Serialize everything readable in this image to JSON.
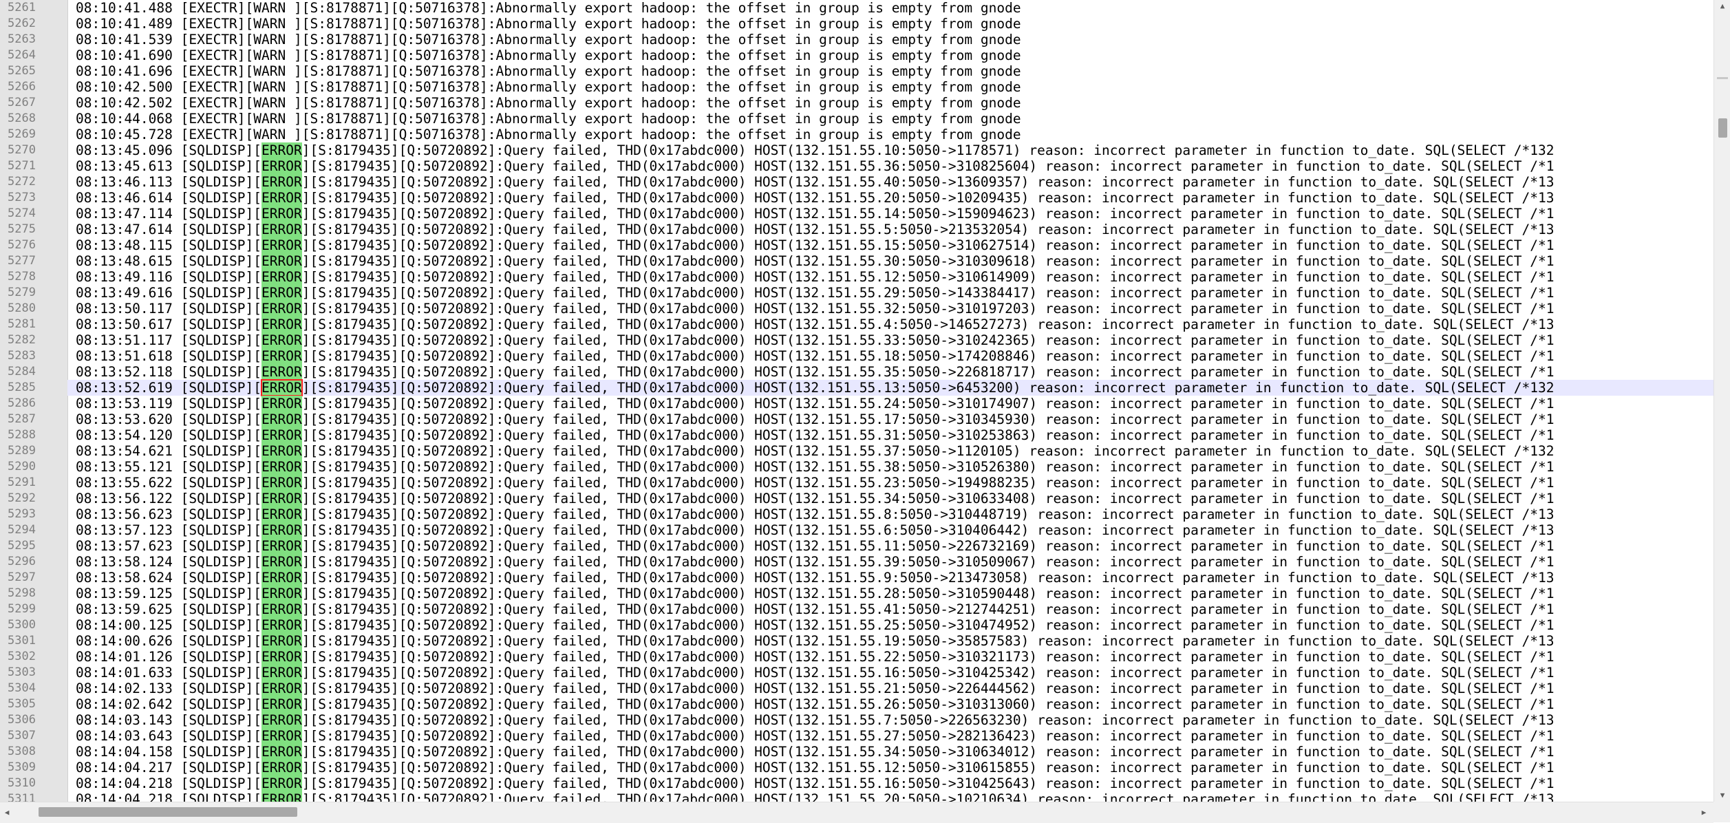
{
  "editor": {
    "current_line": "5285",
    "lines": [
      {
        "n": "5261",
        "pre": "08:10:41.488 [EXECTR][WARN ][S:8178871][Q:50716378]:Abnormally export hadoop: the offset in group is empty from gnode",
        "tag": "",
        "post": ""
      },
      {
        "n": "5262",
        "pre": "08:10:41.489 [EXECTR][WARN ][S:8178871][Q:50716378]:Abnormally export hadoop: the offset in group is empty from gnode",
        "tag": "",
        "post": ""
      },
      {
        "n": "5263",
        "pre": "08:10:41.539 [EXECTR][WARN ][S:8178871][Q:50716378]:Abnormally export hadoop: the offset in group is empty from gnode",
        "tag": "",
        "post": ""
      },
      {
        "n": "5264",
        "pre": "08:10:41.690 [EXECTR][WARN ][S:8178871][Q:50716378]:Abnormally export hadoop: the offset in group is empty from gnode",
        "tag": "",
        "post": ""
      },
      {
        "n": "5265",
        "pre": "08:10:41.696 [EXECTR][WARN ][S:8178871][Q:50716378]:Abnormally export hadoop: the offset in group is empty from gnode",
        "tag": "",
        "post": ""
      },
      {
        "n": "5266",
        "pre": "08:10:42.500 [EXECTR][WARN ][S:8178871][Q:50716378]:Abnormally export hadoop: the offset in group is empty from gnode",
        "tag": "",
        "post": ""
      },
      {
        "n": "5267",
        "pre": "08:10:42.502 [EXECTR][WARN ][S:8178871][Q:50716378]:Abnormally export hadoop: the offset in group is empty from gnode",
        "tag": "",
        "post": ""
      },
      {
        "n": "5268",
        "pre": "08:10:44.068 [EXECTR][WARN ][S:8178871][Q:50716378]:Abnormally export hadoop: the offset in group is empty from gnode",
        "tag": "",
        "post": ""
      },
      {
        "n": "5269",
        "pre": "08:10:45.728 [EXECTR][WARN ][S:8178871][Q:50716378]:Abnormally export hadoop: the offset in group is empty from gnode",
        "tag": "",
        "post": ""
      },
      {
        "n": "5270",
        "pre": "08:13:45.096 [SQLDISP][",
        "tag": "ERROR",
        "post": "][S:8179435][Q:50720892]:Query failed, THD(0x17abdc000) HOST(132.151.55.10:5050->1178571) reason: incorrect parameter in function to_date. SQL(SELECT /*132"
      },
      {
        "n": "5271",
        "pre": "08:13:45.613 [SQLDISP][",
        "tag": "ERROR",
        "post": "][S:8179435][Q:50720892]:Query failed, THD(0x17abdc000) HOST(132.151.55.36:5050->310825604) reason: incorrect parameter in function to_date. SQL(SELECT /*1"
      },
      {
        "n": "5272",
        "pre": "08:13:46.113 [SQLDISP][",
        "tag": "ERROR",
        "post": "][S:8179435][Q:50720892]:Query failed, THD(0x17abdc000) HOST(132.151.55.40:5050->13609357) reason: incorrect parameter in function to_date. SQL(SELECT /*13"
      },
      {
        "n": "5273",
        "pre": "08:13:46.614 [SQLDISP][",
        "tag": "ERROR",
        "post": "][S:8179435][Q:50720892]:Query failed, THD(0x17abdc000) HOST(132.151.55.20:5050->10209435) reason: incorrect parameter in function to_date. SQL(SELECT /*13"
      },
      {
        "n": "5274",
        "pre": "08:13:47.114 [SQLDISP][",
        "tag": "ERROR",
        "post": "][S:8179435][Q:50720892]:Query failed, THD(0x17abdc000) HOST(132.151.55.14:5050->159094623) reason: incorrect parameter in function to_date. SQL(SELECT /*1"
      },
      {
        "n": "5275",
        "pre": "08:13:47.614 [SQLDISP][",
        "tag": "ERROR",
        "post": "][S:8179435][Q:50720892]:Query failed, THD(0x17abdc000) HOST(132.151.55.5:5050->213532054) reason: incorrect parameter in function to_date. SQL(SELECT /*13"
      },
      {
        "n": "5276",
        "pre": "08:13:48.115 [SQLDISP][",
        "tag": "ERROR",
        "post": "][S:8179435][Q:50720892]:Query failed, THD(0x17abdc000) HOST(132.151.55.15:5050->310627514) reason: incorrect parameter in function to_date. SQL(SELECT /*1"
      },
      {
        "n": "5277",
        "pre": "08:13:48.615 [SQLDISP][",
        "tag": "ERROR",
        "post": "][S:8179435][Q:50720892]:Query failed, THD(0x17abdc000) HOST(132.151.55.30:5050->310309618) reason: incorrect parameter in function to_date. SQL(SELECT /*1"
      },
      {
        "n": "5278",
        "pre": "08:13:49.116 [SQLDISP][",
        "tag": "ERROR",
        "post": "][S:8179435][Q:50720892]:Query failed, THD(0x17abdc000) HOST(132.151.55.12:5050->310614909) reason: incorrect parameter in function to_date. SQL(SELECT /*1"
      },
      {
        "n": "5279",
        "pre": "08:13:49.616 [SQLDISP][",
        "tag": "ERROR",
        "post": "][S:8179435][Q:50720892]:Query failed, THD(0x17abdc000) HOST(132.151.55.29:5050->143384417) reason: incorrect parameter in function to_date. SQL(SELECT /*1"
      },
      {
        "n": "5280",
        "pre": "08:13:50.117 [SQLDISP][",
        "tag": "ERROR",
        "post": "][S:8179435][Q:50720892]:Query failed, THD(0x17abdc000) HOST(132.151.55.32:5050->310197203) reason: incorrect parameter in function to_date. SQL(SELECT /*1"
      },
      {
        "n": "5281",
        "pre": "08:13:50.617 [SQLDISP][",
        "tag": "ERROR",
        "post": "][S:8179435][Q:50720892]:Query failed, THD(0x17abdc000) HOST(132.151.55.4:5050->146527273) reason: incorrect parameter in function to_date. SQL(SELECT /*13"
      },
      {
        "n": "5282",
        "pre": "08:13:51.117 [SQLDISP][",
        "tag": "ERROR",
        "post": "][S:8179435][Q:50720892]:Query failed, THD(0x17abdc000) HOST(132.151.55.33:5050->310242365) reason: incorrect parameter in function to_date. SQL(SELECT /*1"
      },
      {
        "n": "5283",
        "pre": "08:13:51.618 [SQLDISP][",
        "tag": "ERROR",
        "post": "][S:8179435][Q:50720892]:Query failed, THD(0x17abdc000) HOST(132.151.55.18:5050->174208846) reason: incorrect parameter in function to_date. SQL(SELECT /*1"
      },
      {
        "n": "5284",
        "pre": "08:13:52.118 [SQLDISP][",
        "tag": "ERROR",
        "post": "][S:8179435][Q:50720892]:Query failed, THD(0x17abdc000) HOST(132.151.55.35:5050->226818717) reason: incorrect parameter in function to_date. SQL(SELECT /*1"
      },
      {
        "n": "5285",
        "pre": "08:13:52.619 [SQLDISP][",
        "tag": "ERROR",
        "post": "][S:8179435][Q:50720892]:Query failed, THD(0x17abdc000) HOST(132.151.55.13:5050->6453200) reason: incorrect parameter in function to_date. SQL(SELECT /*132"
      },
      {
        "n": "5286",
        "pre": "08:13:53.119 [SQLDISP][",
        "tag": "ERROR",
        "post": "][S:8179435][Q:50720892]:Query failed, THD(0x17abdc000) HOST(132.151.55.24:5050->310174907) reason: incorrect parameter in function to_date. SQL(SELECT /*1"
      },
      {
        "n": "5287",
        "pre": "08:13:53.620 [SQLDISP][",
        "tag": "ERROR",
        "post": "][S:8179435][Q:50720892]:Query failed, THD(0x17abdc000) HOST(132.151.55.17:5050->310345930) reason: incorrect parameter in function to_date. SQL(SELECT /*1"
      },
      {
        "n": "5288",
        "pre": "08:13:54.120 [SQLDISP][",
        "tag": "ERROR",
        "post": "][S:8179435][Q:50720892]:Query failed, THD(0x17abdc000) HOST(132.151.55.31:5050->310253863) reason: incorrect parameter in function to_date. SQL(SELECT /*1"
      },
      {
        "n": "5289",
        "pre": "08:13:54.621 [SQLDISP][",
        "tag": "ERROR",
        "post": "][S:8179435][Q:50720892]:Query failed, THD(0x17abdc000) HOST(132.151.55.37:5050->1120105) reason: incorrect parameter in function to_date. SQL(SELECT /*132"
      },
      {
        "n": "5290",
        "pre": "08:13:55.121 [SQLDISP][",
        "tag": "ERROR",
        "post": "][S:8179435][Q:50720892]:Query failed, THD(0x17abdc000) HOST(132.151.55.38:5050->310526380) reason: incorrect parameter in function to_date. SQL(SELECT /*1"
      },
      {
        "n": "5291",
        "pre": "08:13:55.622 [SQLDISP][",
        "tag": "ERROR",
        "post": "][S:8179435][Q:50720892]:Query failed, THD(0x17abdc000) HOST(132.151.55.23:5050->194988235) reason: incorrect parameter in function to_date. SQL(SELECT /*1"
      },
      {
        "n": "5292",
        "pre": "08:13:56.122 [SQLDISP][",
        "tag": "ERROR",
        "post": "][S:8179435][Q:50720892]:Query failed, THD(0x17abdc000) HOST(132.151.55.34:5050->310633408) reason: incorrect parameter in function to_date. SQL(SELECT /*1"
      },
      {
        "n": "5293",
        "pre": "08:13:56.623 [SQLDISP][",
        "tag": "ERROR",
        "post": "][S:8179435][Q:50720892]:Query failed, THD(0x17abdc000) HOST(132.151.55.8:5050->310448719) reason: incorrect parameter in function to_date. SQL(SELECT /*13"
      },
      {
        "n": "5294",
        "pre": "08:13:57.123 [SQLDISP][",
        "tag": "ERROR",
        "post": "][S:8179435][Q:50720892]:Query failed, THD(0x17abdc000) HOST(132.151.55.6:5050->310406442) reason: incorrect parameter in function to_date. SQL(SELECT /*13"
      },
      {
        "n": "5295",
        "pre": "08:13:57.623 [SQLDISP][",
        "tag": "ERROR",
        "post": "][S:8179435][Q:50720892]:Query failed, THD(0x17abdc000) HOST(132.151.55.11:5050->226732169) reason: incorrect parameter in function to_date. SQL(SELECT /*1"
      },
      {
        "n": "5296",
        "pre": "08:13:58.124 [SQLDISP][",
        "tag": "ERROR",
        "post": "][S:8179435][Q:50720892]:Query failed, THD(0x17abdc000) HOST(132.151.55.39:5050->310509067) reason: incorrect parameter in function to_date. SQL(SELECT /*1"
      },
      {
        "n": "5297",
        "pre": "08:13:58.624 [SQLDISP][",
        "tag": "ERROR",
        "post": "][S:8179435][Q:50720892]:Query failed, THD(0x17abdc000) HOST(132.151.55.9:5050->213473058) reason: incorrect parameter in function to_date. SQL(SELECT /*13"
      },
      {
        "n": "5298",
        "pre": "08:13:59.125 [SQLDISP][",
        "tag": "ERROR",
        "post": "][S:8179435][Q:50720892]:Query failed, THD(0x17abdc000) HOST(132.151.55.28:5050->310590448) reason: incorrect parameter in function to_date. SQL(SELECT /*1"
      },
      {
        "n": "5299",
        "pre": "08:13:59.625 [SQLDISP][",
        "tag": "ERROR",
        "post": "][S:8179435][Q:50720892]:Query failed, THD(0x17abdc000) HOST(132.151.55.41:5050->212744251) reason: incorrect parameter in function to_date. SQL(SELECT /*1"
      },
      {
        "n": "5300",
        "pre": "08:14:00.125 [SQLDISP][",
        "tag": "ERROR",
        "post": "][S:8179435][Q:50720892]:Query failed, THD(0x17abdc000) HOST(132.151.55.25:5050->310474952) reason: incorrect parameter in function to_date. SQL(SELECT /*1"
      },
      {
        "n": "5301",
        "pre": "08:14:00.626 [SQLDISP][",
        "tag": "ERROR",
        "post": "][S:8179435][Q:50720892]:Query failed, THD(0x17abdc000) HOST(132.151.55.19:5050->35857583) reason: incorrect parameter in function to_date. SQL(SELECT /*13"
      },
      {
        "n": "5302",
        "pre": "08:14:01.126 [SQLDISP][",
        "tag": "ERROR",
        "post": "][S:8179435][Q:50720892]:Query failed, THD(0x17abdc000) HOST(132.151.55.22:5050->310321173) reason: incorrect parameter in function to_date. SQL(SELECT /*1"
      },
      {
        "n": "5303",
        "pre": "08:14:01.633 [SQLDISP][",
        "tag": "ERROR",
        "post": "][S:8179435][Q:50720892]:Query failed, THD(0x17abdc000) HOST(132.151.55.16:5050->310425342) reason: incorrect parameter in function to_date. SQL(SELECT /*1"
      },
      {
        "n": "5304",
        "pre": "08:14:02.133 [SQLDISP][",
        "tag": "ERROR",
        "post": "][S:8179435][Q:50720892]:Query failed, THD(0x17abdc000) HOST(132.151.55.21:5050->226444562) reason: incorrect parameter in function to_date. SQL(SELECT /*1"
      },
      {
        "n": "5305",
        "pre": "08:14:02.642 [SQLDISP][",
        "tag": "ERROR",
        "post": "][S:8179435][Q:50720892]:Query failed, THD(0x17abdc000) HOST(132.151.55.26:5050->310313060) reason: incorrect parameter in function to_date. SQL(SELECT /*1"
      },
      {
        "n": "5306",
        "pre": "08:14:03.143 [SQLDISP][",
        "tag": "ERROR",
        "post": "][S:8179435][Q:50720892]:Query failed, THD(0x17abdc000) HOST(132.151.55.7:5050->226563230) reason: incorrect parameter in function to_date. SQL(SELECT /*13"
      },
      {
        "n": "5307",
        "pre": "08:14:03.643 [SQLDISP][",
        "tag": "ERROR",
        "post": "][S:8179435][Q:50720892]:Query failed, THD(0x17abdc000) HOST(132.151.55.27:5050->282136423) reason: incorrect parameter in function to_date. SQL(SELECT /*1"
      },
      {
        "n": "5308",
        "pre": "08:14:04.158 [SQLDISP][",
        "tag": "ERROR",
        "post": "][S:8179435][Q:50720892]:Query failed, THD(0x17abdc000) HOST(132.151.55.34:5050->310634012) reason: incorrect parameter in function to_date. SQL(SELECT /*1"
      },
      {
        "n": "5309",
        "pre": "08:14:04.217 [SQLDISP][",
        "tag": "ERROR",
        "post": "][S:8179435][Q:50720892]:Query failed, THD(0x17abdc000) HOST(132.151.55.12:5050->310615855) reason: incorrect parameter in function to_date. SQL(SELECT /*1"
      },
      {
        "n": "5310",
        "pre": "08:14:04.218 [SQLDISP][",
        "tag": "ERROR",
        "post": "][S:8179435][Q:50720892]:Query failed, THD(0x17abdc000) HOST(132.151.55.16:5050->310425643) reason: incorrect parameter in function to_date. SQL(SELECT /*1"
      },
      {
        "n": "5311",
        "pre": "08:14:04.218 [SQLDISP][",
        "tag": "ERROR",
        "post": "][S:8179435][Q:50720892]:Query failed, THD(0x17abdc000) HOST(132.151.55.20:5050->10210634) reason: incorrect parameter in function to_date. SQL(SELECT /*13"
      }
    ]
  },
  "scrollbars": {
    "up_arrow_icon": "triangle-up",
    "down_arrow_icon": "triangle-down",
    "left_arrow_icon": "triangle-left",
    "right_arrow_icon": "triangle-right"
  },
  "colors": {
    "gutter_bg": "#e4e4e4",
    "line_number": "#808080",
    "match_highlight": "#80e080",
    "current_line_bg": "#e8e8ff",
    "brace_match_outline": "#ff2020"
  }
}
